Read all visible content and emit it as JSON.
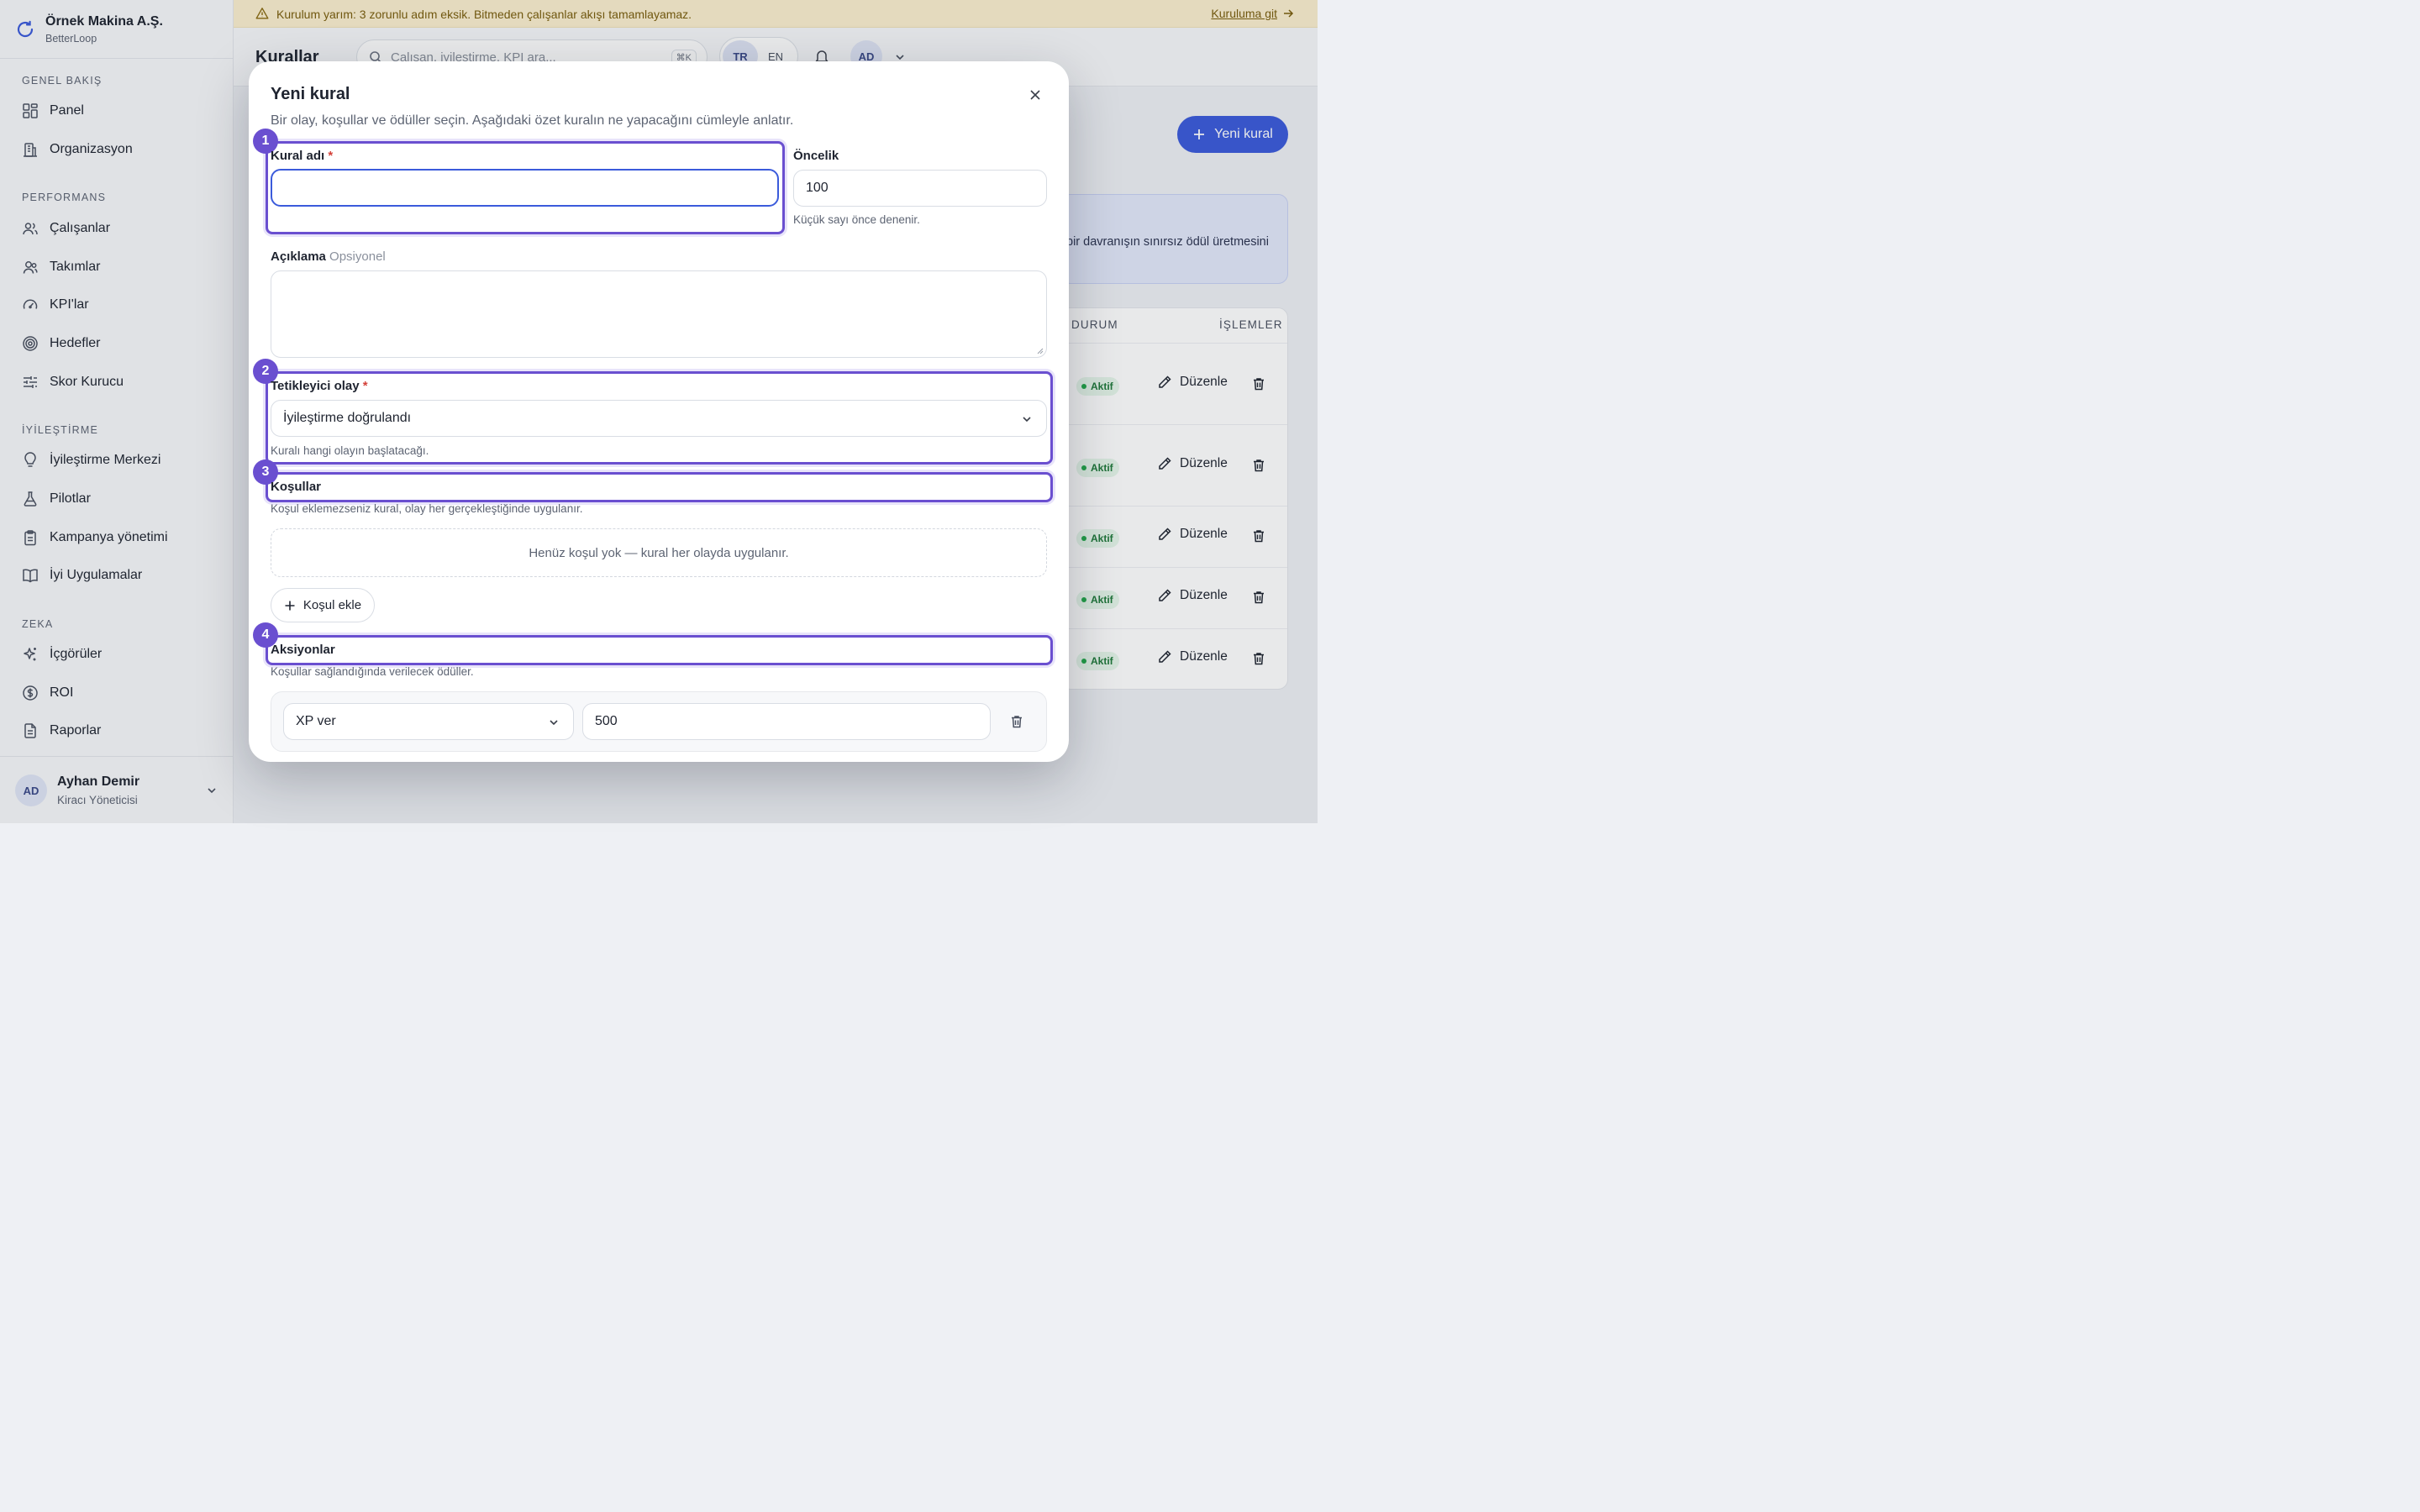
{
  "brand": {
    "name": "Örnek Makina A.Ş.",
    "sub": "BetterLoop"
  },
  "sidebar": {
    "sections": [
      {
        "title": "GENEL BAKIŞ",
        "items": [
          "Panel",
          "Organizasyon"
        ]
      },
      {
        "title": "PERFORMANS",
        "items": [
          "Çalışanlar",
          "Takımlar",
          "KPI'lar",
          "Hedefler",
          "Skor Kurucu"
        ]
      },
      {
        "title": "İYİLEŞTİRME",
        "items": [
          "İyileştirme Merkezi",
          "Pilotlar",
          "Kampanya yönetimi",
          "İyi Uygulamalar"
        ]
      },
      {
        "title": "ZEKA",
        "items": [
          "İçgörüler",
          "ROI",
          "Raporlar"
        ]
      }
    ],
    "user": {
      "initials": "AD",
      "name": "Ayhan Demir",
      "role": "Kiracı Yöneticisi"
    }
  },
  "banner": {
    "message": "Kurulum yarım: 3 zorunlu adım eksik. Bitmeden çalışanlar akışı tamamlayamaz.",
    "link": "Kuruluma git"
  },
  "topbar": {
    "title": "Kurallar",
    "search_placeholder": "Çalışan, iyileştirme, KPI ara...",
    "shortcut": "⌘K",
    "lang": [
      "TR",
      "EN"
    ],
    "avatar": "AD"
  },
  "page": {
    "new_rule_button": "Yeni kural",
    "info_text": "bir davranışın sınırsız ödül üretmesini",
    "table": {
      "headers": [
        "DURUM",
        "İŞLEMLER"
      ],
      "rows": [
        {
          "status": "Aktif",
          "edit": "Düzenle"
        },
        {
          "status": "Aktif",
          "edit": "Düzenle"
        },
        {
          "status": "Aktif",
          "edit": "Düzenle"
        },
        {
          "status": "Aktif",
          "edit": "Düzenle"
        },
        {
          "status": "Aktif",
          "edit": "Düzenle"
        }
      ]
    }
  },
  "modal": {
    "title": "Yeni kural",
    "description": "Bir olay, koşullar ve ödüller seçin. Aşağıdaki özet kuralın ne yapacağını cümleyle anlatır.",
    "rule_name": {
      "label": "Kural adı",
      "required": "*",
      "value": ""
    },
    "priority": {
      "label": "Öncelik",
      "value": "100",
      "hint": "Küçük sayı önce denenir."
    },
    "description_field": {
      "label": "Açıklama",
      "optional": "Opsiyonel",
      "value": ""
    },
    "trigger": {
      "label": "Tetikleyici olay",
      "required": "*",
      "value": "İyileştirme doğrulandı",
      "hint": "Kuralı hangi olayın başlatacağı."
    },
    "conditions": {
      "label": "Koşullar",
      "hint": "Koşul eklemezseniz kural, olay her gerçekleştiğinde uygulanır.",
      "empty": "Henüz koşul yok — kural her olayda uygulanır.",
      "add_button": "Koşul ekle"
    },
    "actions": {
      "label": "Aksiyonlar",
      "hint": "Koşullar sağlandığında verilecek ödüller.",
      "items": [
        {
          "type": "XP ver",
          "value": "500"
        }
      ]
    },
    "steps": [
      "1",
      "2",
      "3",
      "4"
    ]
  },
  "colors": {
    "accent": "#3b5bdb",
    "highlight": "#6a4fd0",
    "success": "#22a84a",
    "warning_bg": "#fbefcf"
  }
}
